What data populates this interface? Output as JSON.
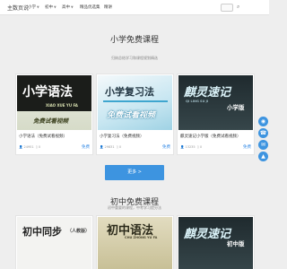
{
  "header": {
    "brand": "主数页说",
    "nav": [
      {
        "label": "小学",
        "has_dropdown": true
      },
      {
        "label": "初中",
        "has_dropdown": true
      },
      {
        "label": "高中",
        "has_dropdown": true
      },
      {
        "label": "精品优选集",
        "has_dropdown": false
      },
      {
        "label": "精讲",
        "has_dropdown": false
      }
    ],
    "search_icon": "search-icon"
  },
  "primary": {
    "title": "小学免费课程",
    "subtitle": "归纳总结学习和课程规划精选",
    "courses": [
      {
        "thumb_main": "小学语法",
        "thumb_sub": "XIAO XUE YU FA",
        "thumb_band": "免费试看视频",
        "title": "小学语法（免费试看视频）",
        "views": "24951",
        "count": "0",
        "price": "免费"
      },
      {
        "thumb_main": "小学复习法",
        "thumb_sub": "",
        "thumb_band": "免费试看视频",
        "title": "小学复习法（免费视频）",
        "views": "29831",
        "count": "0",
        "price": "免费"
      },
      {
        "thumb_main": "麒灵速记",
        "thumb_sub": "QI LING SU JI",
        "thumb_band": "小学版",
        "title": "麒灵速记小学版（免费试看视频）",
        "views": "13235",
        "count": "0",
        "price": "免费"
      }
    ],
    "more_button": "更多 >"
  },
  "secondary": {
    "title": "初中免费课程",
    "subtitle": "初中重要的课程，中考学习提分法",
    "courses": [
      {
        "thumb_main": "初中同步",
        "thumb_sub": "（人教版）"
      },
      {
        "thumb_main": "初中语法",
        "thumb_sub": "CHU ZHONG YU FA"
      },
      {
        "thumb_main": "麒灵速记",
        "thumb_sub": "初中版"
      }
    ]
  },
  "float_buttons": [
    "qq-icon",
    "phone-icon",
    "wechat-icon",
    "top-icon"
  ],
  "colors": {
    "accent": "#3d94e0",
    "page_bg": "#eeeeee"
  }
}
